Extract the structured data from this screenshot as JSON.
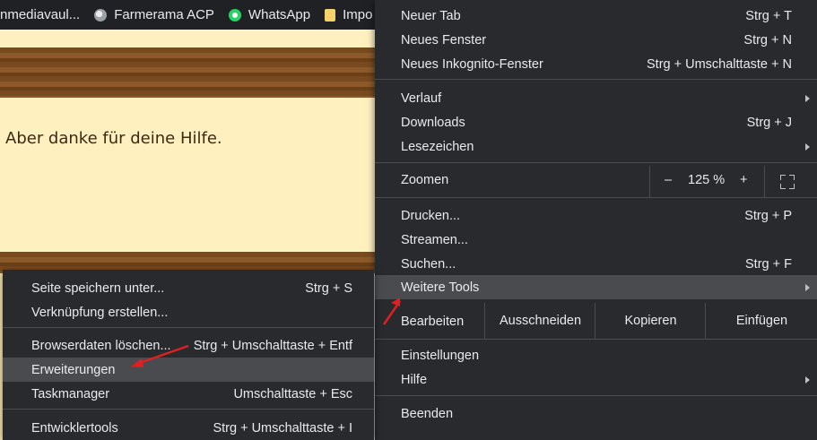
{
  "bookmarks": [
    {
      "label": "nmediavaul...",
      "icon": "none"
    },
    {
      "label": "Farmerama ACP",
      "icon": "globe-icon"
    },
    {
      "label": "WhatsApp",
      "icon": "whatsapp-icon"
    },
    {
      "label": "Impo",
      "icon": "folder-icon"
    }
  ],
  "page": {
    "text": "Aber danke für deine Hilfe."
  },
  "main_menu": {
    "new_tab": {
      "label": "Neuer Tab",
      "shortcut": "Strg + T"
    },
    "new_window": {
      "label": "Neues Fenster",
      "shortcut": "Strg + N"
    },
    "new_incognito": {
      "label": "Neues Inkognito-Fenster",
      "shortcut": "Strg + Umschalttaste + N"
    },
    "history": {
      "label": "Verlauf"
    },
    "downloads": {
      "label": "Downloads",
      "shortcut": "Strg + J"
    },
    "bookmarks": {
      "label": "Lesezeichen"
    },
    "zoom": {
      "label": "Zoomen",
      "minus": "–",
      "value": "125 %",
      "plus": "+"
    },
    "print": {
      "label": "Drucken...",
      "shortcut": "Strg + P"
    },
    "cast": {
      "label": "Streamen..."
    },
    "find": {
      "label": "Suchen...",
      "shortcut": "Strg + F"
    },
    "more_tools": {
      "label": "Weitere Tools"
    },
    "edit": {
      "label": "Bearbeiten",
      "cut": "Ausschneiden",
      "copy": "Kopieren",
      "paste": "Einfügen"
    },
    "settings": {
      "label": "Einstellungen"
    },
    "help": {
      "label": "Hilfe"
    },
    "exit": {
      "label": "Beenden"
    }
  },
  "sub_menu": {
    "save_page": {
      "label": "Seite speichern unter...",
      "shortcut": "Strg + S"
    },
    "create_shortcut": {
      "label": "Verknüpfung erstellen..."
    },
    "clear_data": {
      "label": "Browserdaten löschen...",
      "shortcut": "Strg + Umschalttaste + Entf"
    },
    "extensions": {
      "label": "Erweiterungen"
    },
    "task_manager": {
      "label": "Taskmanager",
      "shortcut": "Umschalttaste + Esc"
    },
    "dev_tools": {
      "label": "Entwicklertools",
      "shortcut": "Strg + Umschalttaste + I"
    }
  },
  "colors": {
    "menu_bg": "#292a2d",
    "highlight": "#4a4b4e",
    "annotation": "#e02020"
  }
}
